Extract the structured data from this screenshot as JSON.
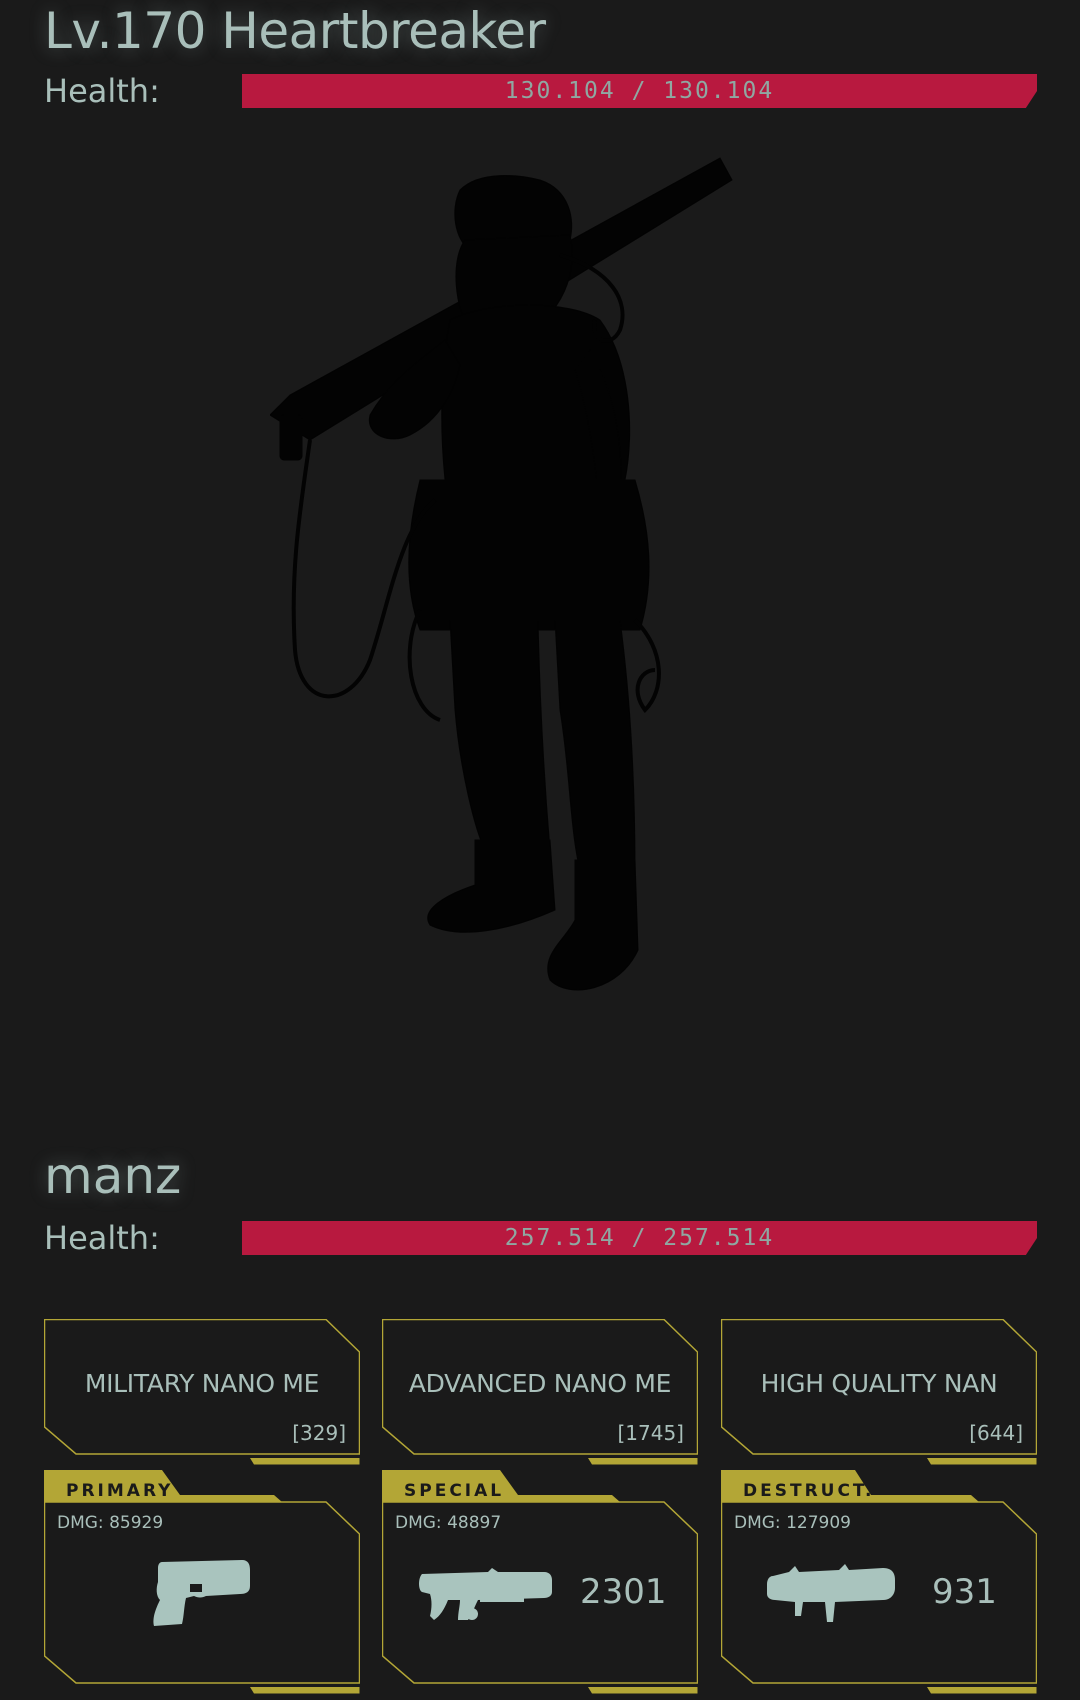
{
  "enemy": {
    "title": "Lv.170 Heartbreaker",
    "health_label": "Health:",
    "health_text": "130.104 / 130.104",
    "health_fraction": 1.0
  },
  "player": {
    "name": "manz",
    "health_label": "Health:",
    "health_text": "257.514 / 257.514",
    "health_fraction": 1.0
  },
  "ammo": [
    {
      "name": "MILITARY NANO ME",
      "count": "[329]"
    },
    {
      "name": "ADVANCED NANO ME",
      "count": "[1745]"
    },
    {
      "name": "HIGH QUALITY NAN",
      "count": "[644]"
    }
  ],
  "weapons": [
    {
      "tag": "PRIMARY",
      "dmg": "DMG: 85929",
      "ammo": "",
      "icon": "pistol-icon"
    },
    {
      "tag": "SPECIAL",
      "dmg": "DMG: 48897",
      "ammo": "2301",
      "icon": "heavy-gun-icon"
    },
    {
      "tag": "DESTRUCT.",
      "dmg": "DMG: 127909",
      "ammo": "931",
      "icon": "rocket-launcher-icon"
    }
  ],
  "colors": {
    "background": "#1a1a1a",
    "text": "#a9bfba",
    "health": "#b8193f",
    "accent": "#b3a636"
  }
}
